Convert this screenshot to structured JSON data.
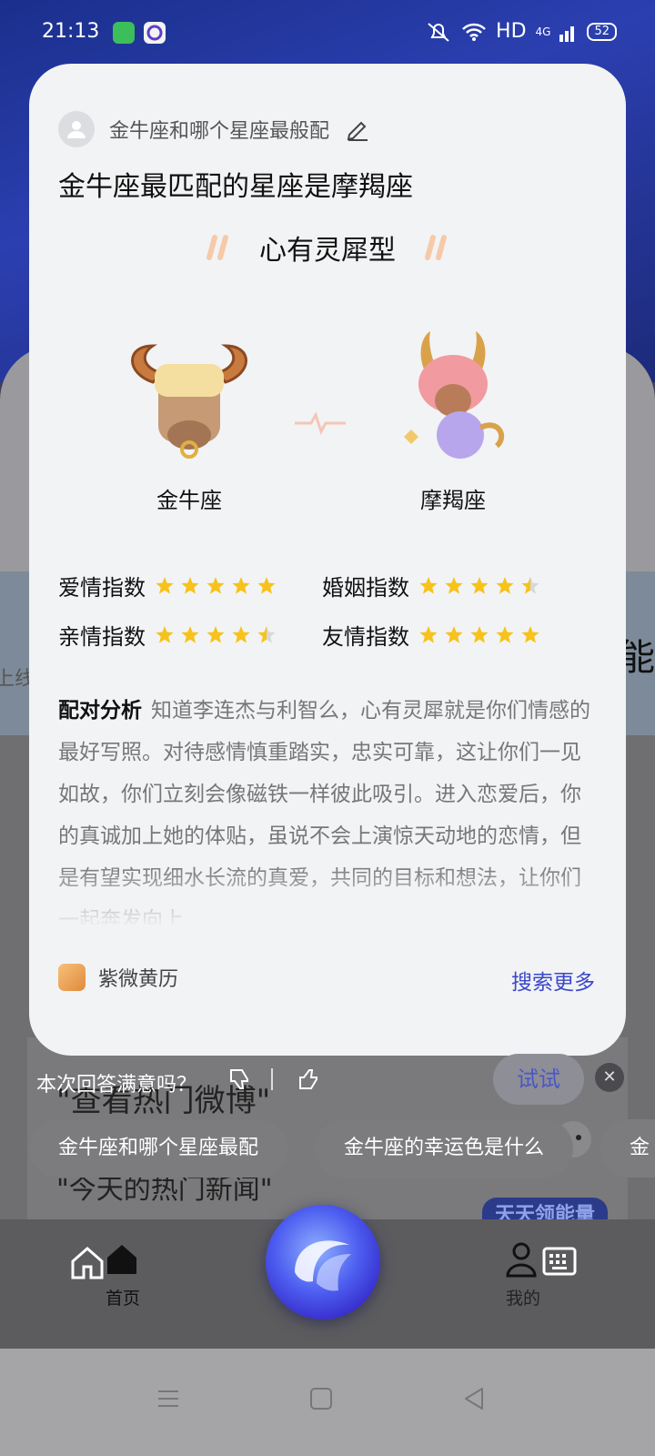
{
  "status_bar": {
    "time": "21:13",
    "network": "HD",
    "signal": "4G",
    "battery": "52"
  },
  "background": {
    "left_partial": "上线",
    "right_partial": "百能",
    "ghost_line_1": "\"查看热门微博\"",
    "ghost_line_2": "\"今天的热门新闻\"",
    "energy_badge": "天天领能量"
  },
  "card": {
    "query": "金牛座和哪个星座最般配",
    "answer_title": "金牛座最匹配的星座是摩羯座",
    "match_type": "心有灵犀型",
    "sign_left": "金牛座",
    "sign_right": "摩羯座",
    "metrics": [
      {
        "label": "爱情指数",
        "rating": 5
      },
      {
        "label": "婚姻指数",
        "rating": 4.5
      },
      {
        "label": "亲情指数",
        "rating": 4.5
      },
      {
        "label": "友情指数",
        "rating": 5
      }
    ],
    "analysis_heading": "配对分析",
    "analysis_text": "知道李连杰与利智么，心有灵犀就是你们情感的最好写照。对待感情慎重踏实，忠实可靠，这让你们一见如故，你们立刻会像磁铁一样彼此吸引。进入恋爱后，你的真诚加上她的体贴，虽说不会上演惊天动地的恋情，但是有望实现细水长流的真爱，共同的目标和想法，让你们一起奔发向上",
    "source_name": "紫微黄历",
    "more_label": "搜索更多"
  },
  "feedback": {
    "question": "本次回答满意吗？",
    "try_label": "试试",
    "close_glyph": "✕"
  },
  "suggestions": [
    "金牛座和哪个星座最配",
    "金牛座的幸运色是什么",
    "金"
  ],
  "bottom_nav": {
    "home_label": "首页",
    "me_label": "我的"
  },
  "colors": {
    "accent_link": "#3a48c8",
    "star": "#f7c21a",
    "card_bg": "#f2f3f5"
  }
}
